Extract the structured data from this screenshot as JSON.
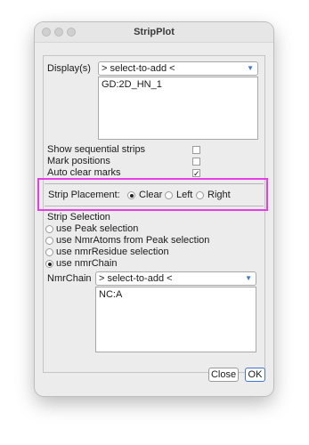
{
  "window": {
    "title": "StripPlot"
  },
  "displays": {
    "label": "Display(s)",
    "combo_value": "> select-to-add <",
    "items": [
      "GD:2D_HN_1"
    ]
  },
  "options": [
    {
      "label": "Show sequential strips",
      "checked": false
    },
    {
      "label": "Mark positions",
      "checked": false
    },
    {
      "label": "Auto clear marks",
      "checked": true
    }
  ],
  "strip_placement": {
    "label": "Strip Placement:",
    "options": [
      "Clear",
      "Left",
      "Right"
    ],
    "selected": "Clear"
  },
  "strip_selection": {
    "label": "Strip Selection",
    "options": [
      "use Peak selection",
      "use NmrAtoms from Peak selection",
      "use nmrResidue selection",
      "use nmrChain"
    ],
    "selected": "use nmrChain"
  },
  "nmr_chain": {
    "label": "NmrChain",
    "combo_value": "> select-to-add <",
    "items": [
      "NC:A"
    ]
  },
  "buttons": {
    "close": "Close",
    "ok": "OK"
  },
  "colors": {
    "highlight": "#e83ce8",
    "accent": "#3e75d6"
  }
}
